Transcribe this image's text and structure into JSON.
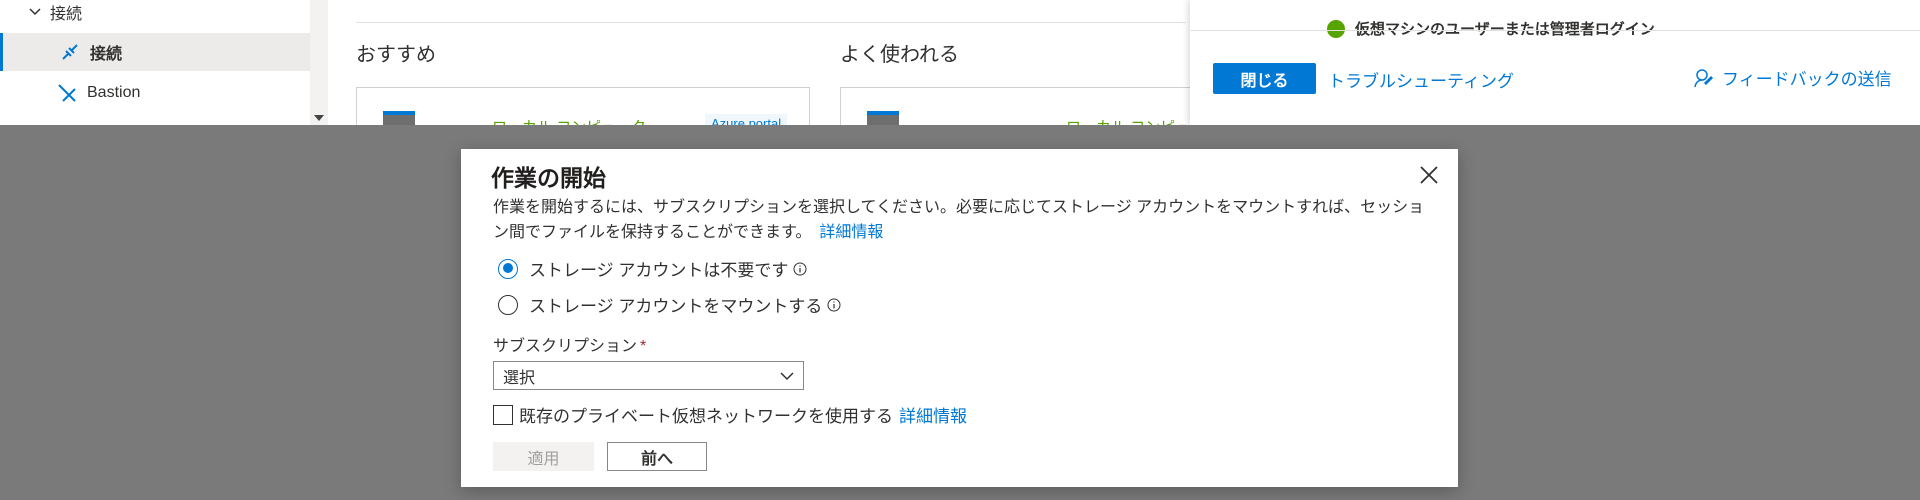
{
  "sidebar": {
    "group_label": "接続",
    "items": [
      {
        "label": "接続",
        "icon": "link-icon"
      },
      {
        "label": "Bastion",
        "icon": "bastion-icon"
      }
    ]
  },
  "content": {
    "recommended_title": "おすすめ",
    "frequent_title": "よく使われる",
    "card1_text": "ローカル コンピューター",
    "card1_tag": "Azure portal",
    "card2_text": "ローカル コンピュー"
  },
  "right_panel": {
    "check_text": "仮想マシンのユーザーまたは管理者ログイン",
    "close_label": "閉じる",
    "troubleshoot_label": "トラブルシューティング",
    "feedback_label": "フィードバックの送信"
  },
  "dialog": {
    "title": "作業の開始",
    "description": "作業を開始するには、サブスクリプションを選択してください。必要に応じてストレージ アカウントをマウントすれば、セッション間でファイルを保持することができます。",
    "learn_more": "詳細情報",
    "radio_no_storage": "ストレージ アカウントは不要です",
    "radio_mount_storage": "ストレージ アカウントをマウントする",
    "subscription_label": "サブスクリプション",
    "required_mark": "*",
    "subscription_value": "選択",
    "vnet_label": "既存のプライベート仮想ネットワークを使用する",
    "vnet_learn_more": "詳細情報",
    "apply_label": "適用",
    "prev_label": "前へ"
  },
  "colors": {
    "accent": "#0078d4",
    "overlay": "#7a7a7a",
    "success": "#57a300"
  }
}
